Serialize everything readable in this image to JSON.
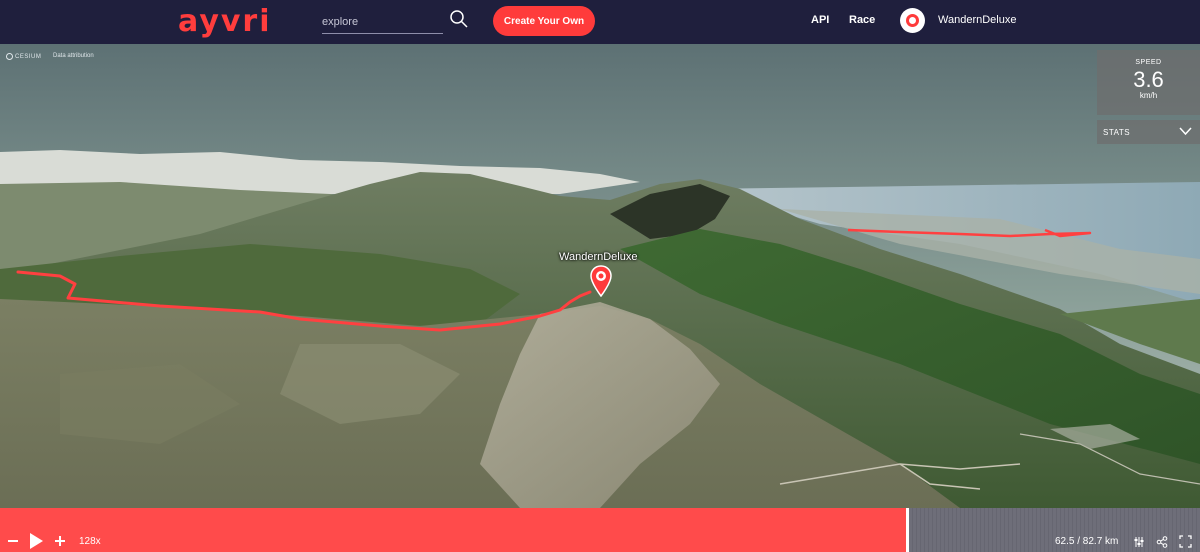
{
  "header": {
    "logo": "ayvri",
    "search_placeholder": "explore",
    "create_button": "Create Your Own",
    "nav_api": "API",
    "nav_race": "Race",
    "username": "WandernDeluxe"
  },
  "map": {
    "credit_cesium": "CESIUM",
    "data_attribution": "Data attribution",
    "athlete_label": "WandernDeluxe"
  },
  "speed_panel": {
    "label": "SPEED",
    "value": "3.6",
    "unit": "km/h"
  },
  "stats_dropdown": {
    "label": "STATS"
  },
  "playback": {
    "multiplier": "128x",
    "distance": "62.5 / 82.7 km",
    "progress_fraction": 0.756
  },
  "colors": {
    "accent": "#ff3b3b",
    "header_bg": "#1f1f3d",
    "track": "#ff4040"
  },
  "icons": [
    "search-icon",
    "location-pin-icon",
    "chevron-down-icon",
    "minus-icon",
    "play-icon",
    "plus-icon",
    "settings-sliders-icon",
    "share-icon",
    "fullscreen-icon"
  ]
}
